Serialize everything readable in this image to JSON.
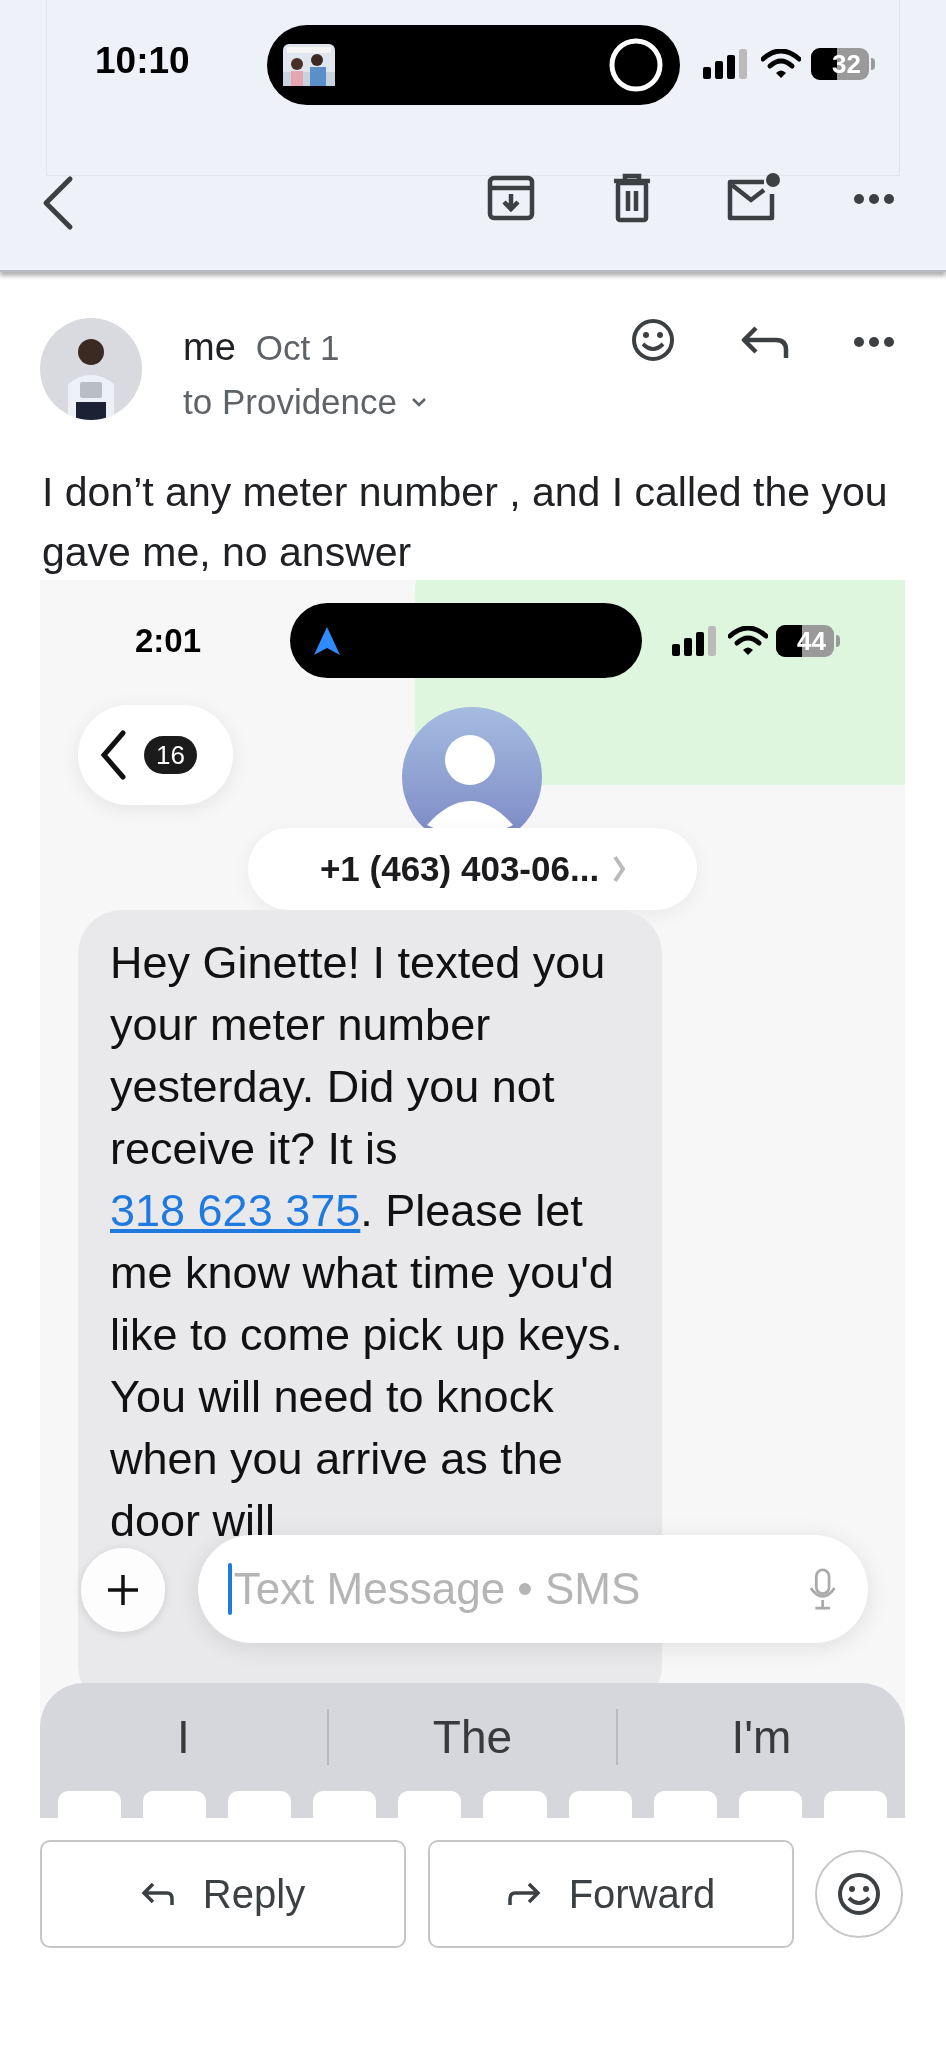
{
  "status_bar": {
    "time": "10:10",
    "battery": "32"
  },
  "message": {
    "sender": "me",
    "date": "Oct 1",
    "recipient": "to Providence",
    "body": "I don’t any meter number , and I called the you gave me, no answer"
  },
  "attachment": {
    "status_bar": {
      "time": "2:01",
      "battery": "44"
    },
    "back_count": "16",
    "contact": "+1 (463) 403-06...",
    "text_message": {
      "before": "Hey Ginette! I texted you your meter number yesterday. Did you not receive it? It is ",
      "link": "318 623 375",
      "after": ". Please let me know what time you'd like to come pick up keys. You will need to knock when you arrive as the door will"
    },
    "input": {
      "placeholder": "Text Message • SMS"
    },
    "suggestions": [
      "I",
      "The",
      "I'm"
    ]
  },
  "actions": [
    {
      "label": "Reply",
      "kind": "reply"
    },
    {
      "label": "Forward",
      "kind": "forward"
    }
  ]
}
